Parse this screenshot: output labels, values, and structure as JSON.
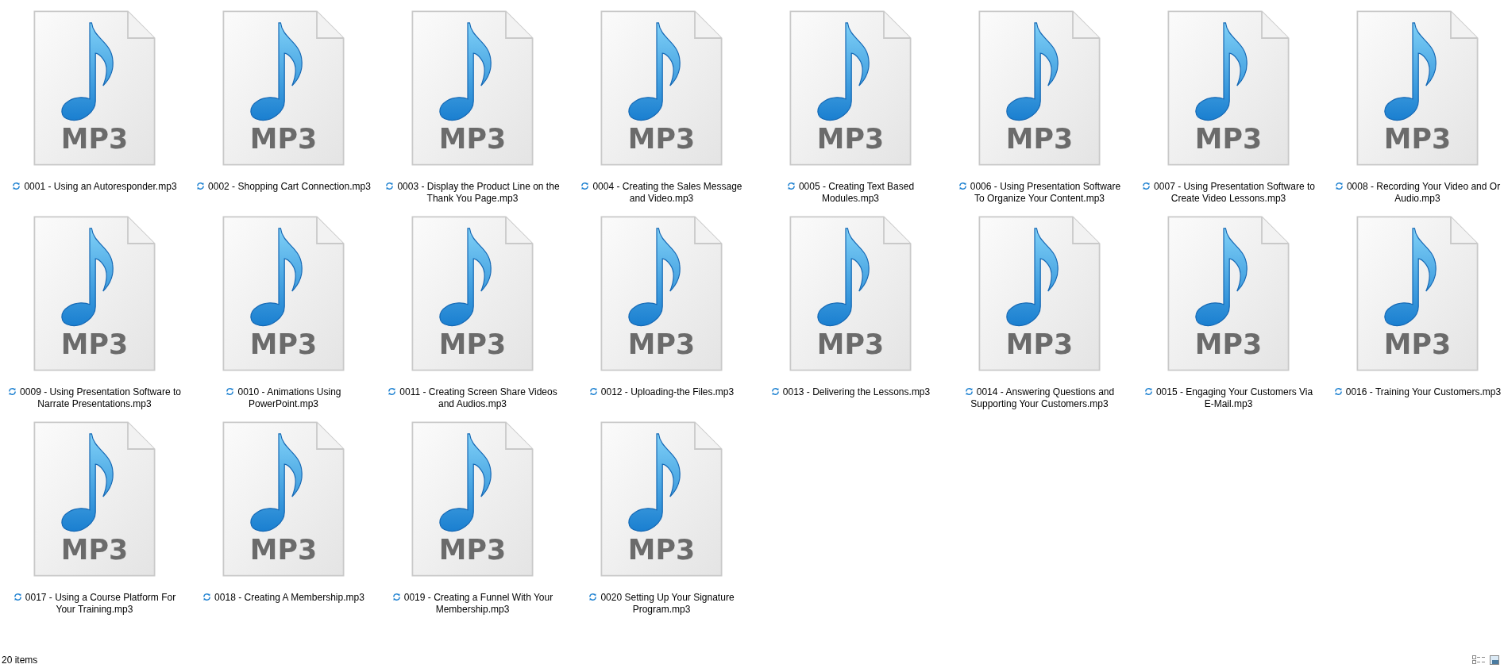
{
  "files": [
    {
      "name": "0001 - Using an Autoresponder.mp3",
      "badge": "MP3"
    },
    {
      "name": "0002 - Shopping Cart Connection.mp3",
      "badge": "MP3"
    },
    {
      "name": "0003 - Display the Product Line on the Thank You Page.mp3",
      "badge": "MP3"
    },
    {
      "name": "0004 - Creating the Sales Message and Video.mp3",
      "badge": "MP3"
    },
    {
      "name": "0005 - Creating Text Based Modules.mp3",
      "badge": "MP3"
    },
    {
      "name": "0006 - Using Presentation Software To Organize Your Content.mp3",
      "badge": "MP3"
    },
    {
      "name": "0007 - Using Presentation Software to Create Video Lessons.mp3",
      "badge": "MP3"
    },
    {
      "name": "0008 - Recording Your Video and Or Audio.mp3",
      "badge": "MP3"
    },
    {
      "name": "0009 - Using Presentation Software to Narrate Presentations.mp3",
      "badge": "MP3"
    },
    {
      "name": "0010 - Animations Using PowerPoint.mp3",
      "badge": "MP3"
    },
    {
      "name": "0011 - Creating Screen Share Videos and Audios.mp3",
      "badge": "MP3"
    },
    {
      "name": "0012 - Uploading-the Files.mp3",
      "badge": "MP3"
    },
    {
      "name": "0013 - Delivering the Lessons.mp3",
      "badge": "MP3"
    },
    {
      "name": "0014 - Answering Questions and Supporting Your Customers.mp3",
      "badge": "MP3"
    },
    {
      "name": "0015 - Engaging Your Customers Via E-Mail.mp3",
      "badge": "MP3"
    },
    {
      "name": "0016 - Training Your Customers.mp3",
      "badge": "MP3"
    },
    {
      "name": "0017 - Using a Course Platform For Your Training.mp3",
      "badge": "MP3"
    },
    {
      "name": "0018 - Creating A Membership.mp3",
      "badge": "MP3"
    },
    {
      "name": "0019 - Creating a Funnel With Your Membership.mp3",
      "badge": "MP3"
    },
    {
      "name": "0020  Setting Up Your Signature Program.mp3",
      "badge": "MP3"
    }
  ],
  "status_bar": {
    "count": "20 items"
  }
}
